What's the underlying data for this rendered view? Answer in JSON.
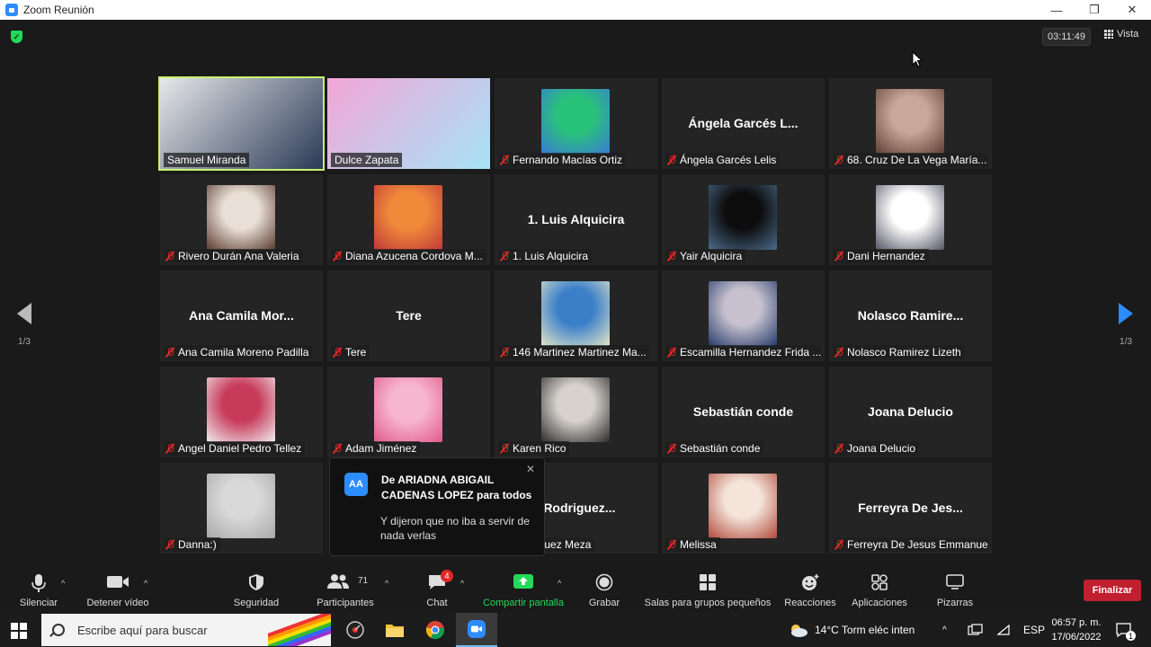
{
  "window": {
    "title": "Zoom Reunión",
    "minimize": "—",
    "restore": "❐",
    "close": "✕"
  },
  "header": {
    "timer": "03:11:49",
    "view_label": "Vista"
  },
  "pagination": {
    "left": "1/3",
    "right": "1/3"
  },
  "participants": [
    {
      "name": "Samuel Miranda",
      "tile": "video",
      "muted": false,
      "active": true,
      "video_colors": [
        "#e6e8ea",
        "#2b3a56"
      ]
    },
    {
      "name": "Dulce Zapata",
      "tile": "video",
      "muted": false,
      "video_colors": [
        "#f3a6d8",
        "#a6e3f5"
      ]
    },
    {
      "name": "Fernando Macías Ortiz",
      "tile": "avatar",
      "muted": true,
      "avatar_colors": [
        "#29c27a",
        "#3a7bd5"
      ]
    },
    {
      "name": "Ángela Garcés Lelis",
      "display": "Ángela Garcés L...",
      "tile": "text",
      "muted": true
    },
    {
      "name": "68. Cruz De La Vega María...",
      "tile": "avatar",
      "muted": true,
      "avatar_colors": [
        "#c9a89a",
        "#5e3f34"
      ]
    },
    {
      "name": "Rivero Durán Ana Valeria",
      "tile": "avatar",
      "muted": true,
      "avatar_colors": [
        "#e9dfd6",
        "#5a3a2e"
      ]
    },
    {
      "name": "Diana Azucena Cordova M...",
      "tile": "avatar",
      "muted": true,
      "avatar_colors": [
        "#f08a3a",
        "#c13838"
      ]
    },
    {
      "name": "1. Luis Alquicira",
      "display": "1. Luis Alquicira",
      "tile": "text",
      "muted": true
    },
    {
      "name": "Yair Alquicira",
      "tile": "avatar",
      "muted": true,
      "avatar_colors": [
        "#0d0d0d",
        "#4a6b8a"
      ]
    },
    {
      "name": "Dani Hernandez",
      "tile": "avatar",
      "muted": true,
      "avatar_colors": [
        "#ffffff",
        "#555566"
      ]
    },
    {
      "name": "Ana Camila Moreno Padilla",
      "display": "Ana Camila Mor...",
      "tile": "text",
      "muted": true
    },
    {
      "name": "Tere",
      "display": "Tere",
      "tile": "text",
      "muted": true
    },
    {
      "name": "146 Martinez Martinez Ma...",
      "tile": "avatar",
      "muted": true,
      "avatar_colors": [
        "#3b7fc9",
        "#e3e6c8"
      ]
    },
    {
      "name": "Escamilla Hernandez Frida ...",
      "tile": "avatar",
      "muted": true,
      "avatar_colors": [
        "#c7c1cf",
        "#233a6a"
      ]
    },
    {
      "name": "Nolasco Ramirez Lizeth",
      "display": "Nolasco Ramire...",
      "tile": "text",
      "muted": true
    },
    {
      "name": "Angel Daniel Pedro Tellez",
      "tile": "avatar",
      "muted": true,
      "avatar_colors": [
        "#c83a5a",
        "#f0f0f0"
      ]
    },
    {
      "name": "Adam Jiménez",
      "tile": "avatar",
      "muted": true,
      "avatar_colors": [
        "#f7b6cf",
        "#e05a8a"
      ]
    },
    {
      "name": "Karen Rico",
      "tile": "avatar",
      "muted": true,
      "avatar_colors": [
        "#d8d2cc",
        "#2a2a2a"
      ]
    },
    {
      "name": "Sebastián conde",
      "display": "Sebastián conde",
      "tile": "text",
      "muted": true
    },
    {
      "name": "Joana Delucio",
      "display": "Joana Delucio",
      "tile": "text",
      "muted": true
    },
    {
      "name": "Danna:)",
      "tile": "avatar",
      "muted": true,
      "avatar_colors": [
        "#d9d9d9",
        "#a9a9a9"
      ]
    },
    {
      "name": "",
      "tile": "hidden",
      "muted": false
    },
    {
      "name": "Rodriguez Meza",
      "display": "i  Rodriguez...",
      "tile": "text",
      "muted": true
    },
    {
      "name": "Melissa",
      "tile": "avatar",
      "muted": true,
      "avatar_colors": [
        "#f4e4da",
        "#b04a3a"
      ]
    },
    {
      "name": "Ferreyra De Jesus Emmanuel",
      "display": "Ferreyra De Jes...",
      "tile": "text",
      "muted": true
    }
  ],
  "chat_toast": {
    "initials": "AA",
    "from": "De ARIADNA ABIGAIL CADENAS LOPEZ para todos",
    "message": "Y dijeron que no iba a servir de nada verlas",
    "close": "✕"
  },
  "toolbar": {
    "mute": "Silenciar",
    "video": "Detener vídeo",
    "security": "Seguridad",
    "participants": "Participantes",
    "participants_count": "71",
    "chat": "Chat",
    "chat_badge": "4",
    "share": "Compartir pantalla",
    "record": "Grabar",
    "breakout": "Salas para grupos pequeños",
    "reactions": "Reacciones",
    "apps": "Aplicaciones",
    "whiteboards": "Pizarras",
    "end": "Finalizar"
  },
  "taskbar": {
    "search_placeholder": "Escribe aquí para buscar",
    "weather": "14°C  Torm eléc inten",
    "lang": "ESP",
    "time": "06:57 p. m.",
    "date": "17/06/2022",
    "notifications": "1"
  }
}
